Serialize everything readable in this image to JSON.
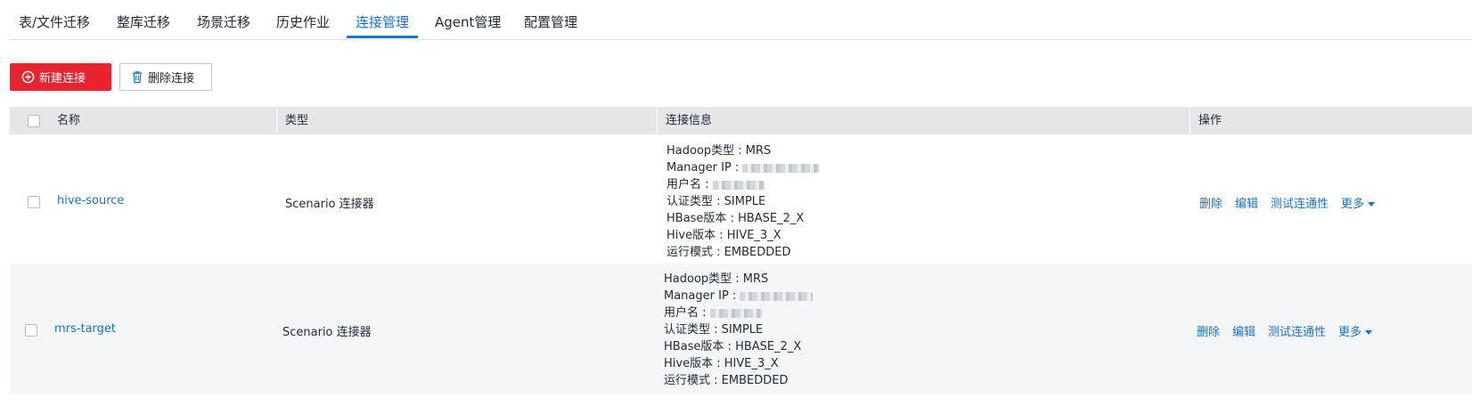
{
  "tabs": [
    {
      "label": "表/文件迁移"
    },
    {
      "label": "整库迁移"
    },
    {
      "label": "场景迁移"
    },
    {
      "label": "历史作业"
    },
    {
      "label": "连接管理",
      "active": true
    },
    {
      "label": "Agent管理"
    },
    {
      "label": "配置管理"
    }
  ],
  "toolbar": {
    "new_label": "新建连接",
    "delete_label": "删除连接"
  },
  "table": {
    "headers": {
      "name": "名称",
      "type": "类型",
      "info": "连接信息",
      "ops": "操作"
    },
    "rows": [
      {
        "name": "hive-source",
        "type": "Scenario 连接器",
        "info": {
          "hadoop": "Hadoop类型 : MRS",
          "manager_ip": "Manager IP : ",
          "user": "用户名 : ",
          "auth": "认证类型 : SIMPLE",
          "hbase": "HBase版本 : HBASE_2_X",
          "hive": "Hive版本 : HIVE_3_X",
          "mode": "运行模式 : EMBEDDED"
        },
        "ops": {
          "delete": "删除",
          "edit": "编辑",
          "test": "测试连通性",
          "more": "更多"
        }
      },
      {
        "name": "mrs-target",
        "type": "Scenario 连接器",
        "info": {
          "hadoop": "Hadoop类型 : MRS",
          "manager_ip": "Manager IP : ",
          "user": "用户名 : ",
          "auth": "认证类型 : SIMPLE",
          "hbase": "HBase版本 : HBASE_2_X",
          "hive": "Hive版本 : HIVE_3_X",
          "mode": "运行模式 : EMBEDDED"
        },
        "ops": {
          "delete": "删除",
          "edit": "编辑",
          "test": "测试连通性",
          "more": "更多"
        }
      }
    ]
  },
  "colors": {
    "accent": "#1a73c8",
    "primary_button": "#e8232f",
    "header_bg": "#e4e6e8",
    "row_alt_bg": "#f5f6f7"
  },
  "icons": {
    "new": "plus-circle-icon",
    "delete": "trash-icon",
    "more": "caret-down-icon"
  }
}
